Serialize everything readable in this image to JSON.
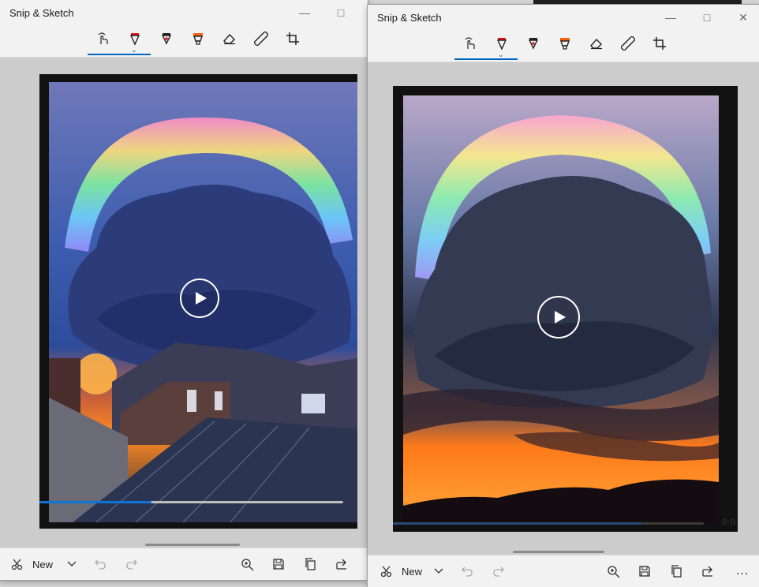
{
  "app_title": "Snip & Sketch",
  "toolbar": {
    "tools": [
      "touch-writing",
      "ballpoint-pen",
      "pencil",
      "highlighter",
      "eraser",
      "ruler",
      "image-crop"
    ]
  },
  "bottom": {
    "new_label": "New",
    "more_label": "..."
  },
  "left_window": {
    "progress_fraction": 0.37
  },
  "right_window": {
    "progress_fraction": 0.8,
    "timecode": "0:0"
  },
  "colors": {
    "accent": "#0067c0",
    "titlebar": "#f2f2f2",
    "canvas": "#cccccc",
    "sunset_orange": "#ff7a1a",
    "sky_blue": "#3c5aa8"
  }
}
